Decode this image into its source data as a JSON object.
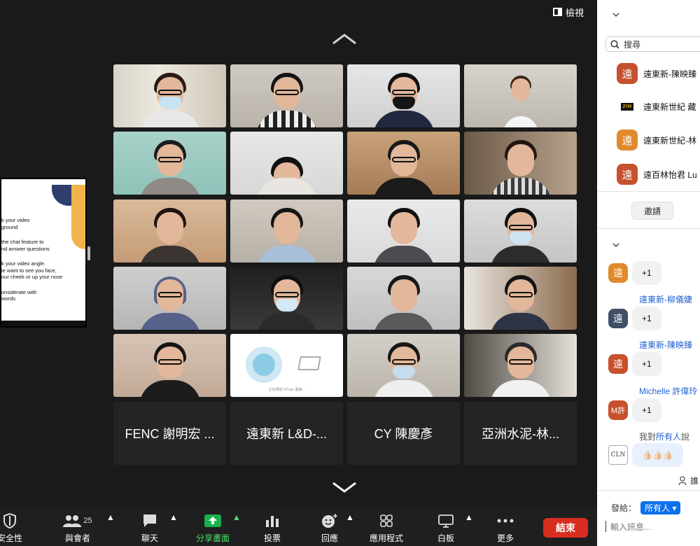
{
  "meeting": {
    "view_label": "檢視",
    "share": {
      "lines": [
        "k your video\nground",
        "the chat feature to\nnd answer questions",
        "k your video angle.\nle want to see you face,\nour cheek or up your nose",
        "onsiderate with\nwords"
      ]
    },
    "logo_caption": "正在傳送 iVCam 連接...",
    "name_tiles": [
      "FENC 謝明宏 ...",
      "遠東新 L&D-...",
      "CY 陳慶彥",
      "亞洲水泥-林..."
    ]
  },
  "toolbar": {
    "security": "安全性",
    "participants": "與會者",
    "participant_count": "25",
    "chat": "聊天",
    "share": "分享畫面",
    "poll": "投票",
    "reactions": "回應",
    "apps": "應用程式",
    "whiteboard": "白板",
    "more": "更多",
    "end": "結束"
  },
  "panel": {
    "search_placeholder": "搜尋",
    "participants": [
      {
        "avatar": "遠",
        "name": "遠東新-陳映臻"
      },
      {
        "avatar": "JIH",
        "name": "遠東新世紀 藏"
      },
      {
        "avatar": "遠",
        "name": "遠東新世紀-林"
      },
      {
        "avatar": "遠",
        "name": "遠百林怡君 Lu"
      }
    ],
    "invite": "邀請",
    "chat": [
      {
        "avatar": "遠",
        "text": "+1"
      },
      {
        "sender": "遠東新-柳儀婕",
        "avatar": "遠",
        "text": "+1"
      },
      {
        "sender": "遠東新-陳映臻",
        "avatar": "遠",
        "text": "+1"
      },
      {
        "sender": "Michelle 許偉玲",
        "avatar": "M許",
        "text": "+1"
      },
      {
        "sender_prefix": "我對",
        "sender_target": "所有人",
        "sender_suffix": "說",
        "avatar": "CLN",
        "text": "👍🏻👍🏻👍🏻"
      }
    ],
    "who_label": "誰",
    "send_to_label": "發給：",
    "send_to_value": "所有人",
    "input_placeholder": "輸入訊息..."
  }
}
